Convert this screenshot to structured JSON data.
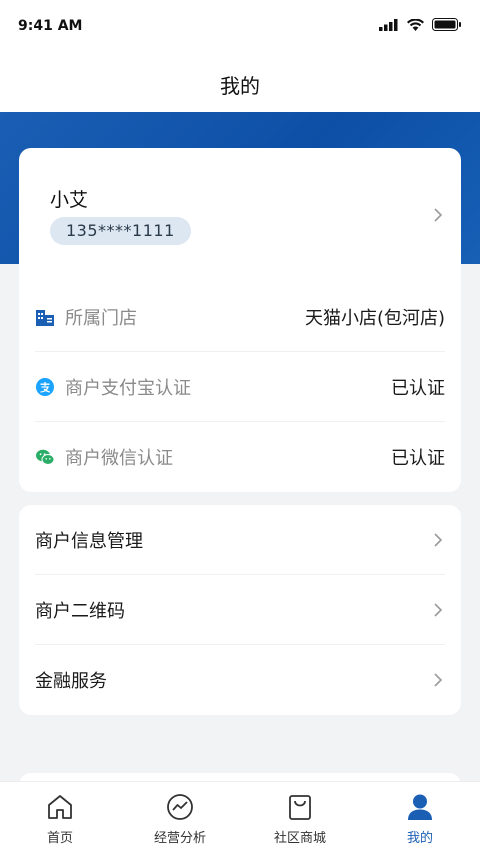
{
  "status_bar": {
    "time": "9:41 AM"
  },
  "header": {
    "title": "我的"
  },
  "profile": {
    "name": "小艾",
    "phone": "135****1111"
  },
  "info_rows": [
    {
      "label": "所属门店",
      "value": "天猫小店(包河店)",
      "icon": "store-icon"
    },
    {
      "label": "商户支付宝认证",
      "value": "已认证",
      "icon": "alipay-icon"
    },
    {
      "label": "商户微信认证",
      "value": "已认证",
      "icon": "wechat-icon"
    }
  ],
  "menu": [
    {
      "label": "商户信息管理"
    },
    {
      "label": "商户二维码"
    },
    {
      "label": "金融服务"
    }
  ],
  "tabs": [
    {
      "label": "首页",
      "icon": "home-icon"
    },
    {
      "label": "经营分析",
      "icon": "analytics-icon"
    },
    {
      "label": "社区商城",
      "icon": "shopping-bag-icon"
    },
    {
      "label": "我的",
      "icon": "user-icon"
    }
  ],
  "colors": {
    "accent": "#1b5fb4",
    "banner": "#0d4fa6",
    "alipay": "#1aa3ff",
    "wechat": "#2aae67"
  }
}
